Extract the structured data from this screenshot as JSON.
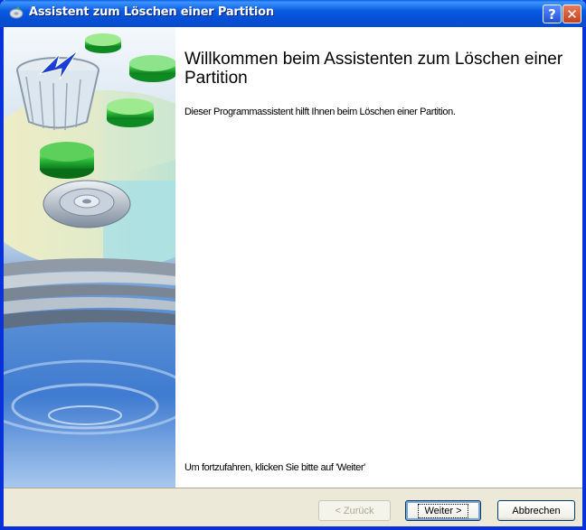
{
  "window": {
    "title": "Assistent zum Löschen einer Partition",
    "help_glyph": "?",
    "close_glyph": "✕"
  },
  "main": {
    "heading": "Willkommen beim Assistenten zum Löschen einer Partition",
    "intro": "Dieser Programmassistent hilft Ihnen beim Löschen einer Partition.",
    "continue_hint": "Um fortzufahren, klicken Sie bitte auf 'Weiter'"
  },
  "buttons": {
    "back": "< Zurück",
    "next": "Weiter >",
    "cancel": "Abbrechen"
  },
  "colors": {
    "titlebar": "#0A5BE0",
    "frame": "#0831D9",
    "dialog_bg": "#ECE9D8",
    "close": "#C4401C"
  },
  "icons": {
    "title": "disk-wizard-icon",
    "help": "help-icon",
    "close": "close-icon",
    "illustration": "disks-and-recycle-bin-illustration"
  }
}
